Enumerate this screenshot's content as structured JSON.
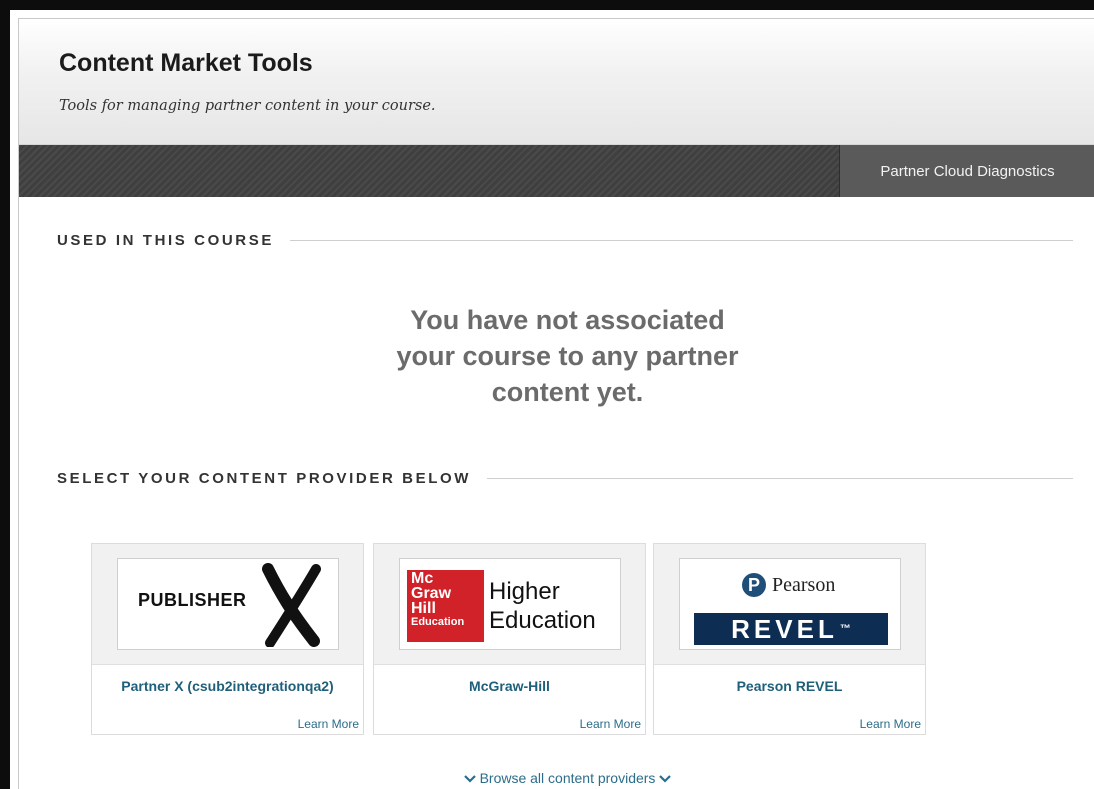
{
  "header": {
    "title": "Content Market Tools",
    "subtitle": "Tools for managing partner content in your course."
  },
  "toolbar": {
    "diagnostics_label": "Partner Cloud Diagnostics"
  },
  "used_section": {
    "heading": "USED IN THIS COURSE",
    "empty_message_lines": [
      "You have not associated",
      "your course to any partner",
      "content yet."
    ]
  },
  "providers_section": {
    "heading": "SELECT YOUR CONTENT PROVIDER BELOW",
    "providers": [
      {
        "name": "Partner X (csub2integrationqa2)",
        "learn_more": "Learn More",
        "logo_text": "PUBLISHER"
      },
      {
        "name": "McGraw-Hill",
        "learn_more": "Learn More",
        "logo_lines": [
          "Mc",
          "Graw",
          "Hill",
          "Education"
        ],
        "logo_tagline": [
          "Higher",
          "Education"
        ]
      },
      {
        "name": "Pearson REVEL",
        "learn_more": "Learn More",
        "logo_brand": "Pearson",
        "logo_product": "REVEL",
        "logo_mark": "™"
      }
    ],
    "browse_label": "Browse all content providers"
  },
  "colors": {
    "accent_link": "#1f5f7a",
    "toolbar_bg": "#3f3f3f",
    "mgh_red": "#d12229",
    "pearson_navy": "#0e2d52"
  }
}
